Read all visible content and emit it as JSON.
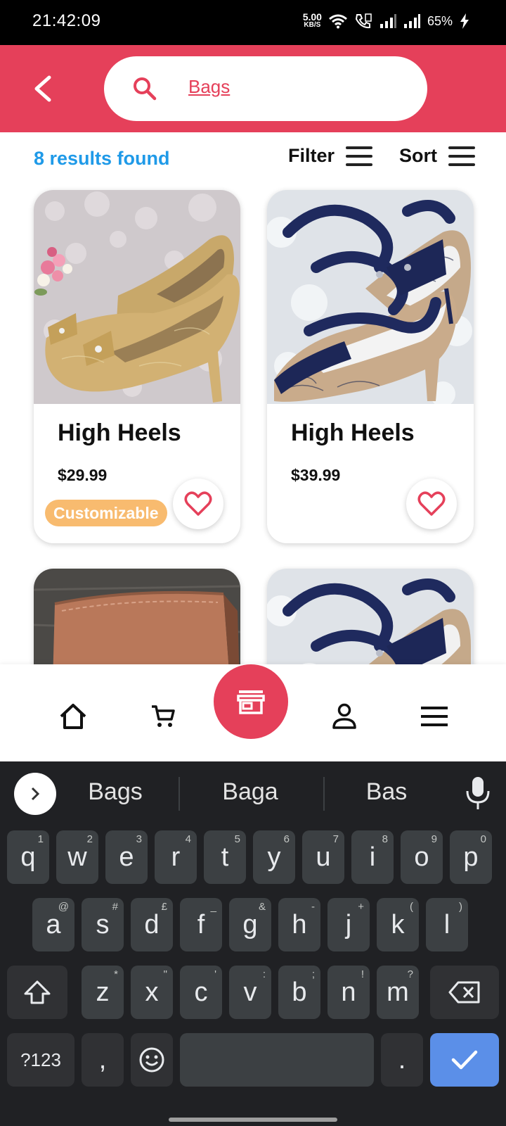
{
  "status_bar": {
    "time": "21:42:09",
    "net_speed_value": "5.00",
    "net_speed_unit": "KB/S",
    "battery": "65%",
    "icons": [
      "wifi-icon",
      "call-icon",
      "signal-icon",
      "signal-icon",
      "battery-charging-icon"
    ]
  },
  "header": {
    "back_icon": "chevron-left-icon",
    "search_icon": "search-icon",
    "search_value": "Bags",
    "accent_color": "#e5405a"
  },
  "results": {
    "count_text": "8 results found",
    "filter_label": "Filter",
    "sort_label": "Sort"
  },
  "products": [
    {
      "title": "High Heels",
      "price": "$29.99",
      "badge": "Customizable",
      "image": "gold-lace-heels"
    },
    {
      "title": "High Heels",
      "price": "$39.99",
      "badge": "",
      "image": "navy-lace-heels"
    },
    {
      "title": "",
      "price": "",
      "badge": "",
      "image": "brown-leather-wallet"
    },
    {
      "title": "",
      "price": "",
      "badge": "",
      "image": "navy-lace-heels"
    }
  ],
  "bottom_nav": {
    "items": [
      "home-icon",
      "cart-icon",
      "store-icon",
      "person-icon",
      "menu-icon"
    ],
    "active": "store-icon"
  },
  "keyboard": {
    "suggestions": [
      "Bags",
      "Baga",
      "Bas"
    ],
    "row1": [
      {
        "k": "q",
        "h": "1"
      },
      {
        "k": "w",
        "h": "2"
      },
      {
        "k": "e",
        "h": "3"
      },
      {
        "k": "r",
        "h": "4"
      },
      {
        "k": "t",
        "h": "5"
      },
      {
        "k": "y",
        "h": "6"
      },
      {
        "k": "u",
        "h": "7"
      },
      {
        "k": "i",
        "h": "8"
      },
      {
        "k": "o",
        "h": "9"
      },
      {
        "k": "p",
        "h": "0"
      }
    ],
    "row2": [
      {
        "k": "a",
        "h": "@"
      },
      {
        "k": "s",
        "h": "#"
      },
      {
        "k": "d",
        "h": "£"
      },
      {
        "k": "f",
        "h": "_"
      },
      {
        "k": "g",
        "h": "&"
      },
      {
        "k": "h",
        "h": "-"
      },
      {
        "k": "j",
        "h": "+"
      },
      {
        "k": "k",
        "h": "("
      },
      {
        "k": "l",
        "h": ")"
      }
    ],
    "row3": [
      {
        "k": "z",
        "h": "*"
      },
      {
        "k": "x",
        "h": "\""
      },
      {
        "k": "c",
        "h": "'"
      },
      {
        "k": "v",
        "h": ":"
      },
      {
        "k": "b",
        "h": ";"
      },
      {
        "k": "n",
        "h": "!"
      },
      {
        "k": "m",
        "h": "?"
      }
    ],
    "symbols_key": "?123",
    "comma_key": ",",
    "period_key": "."
  }
}
